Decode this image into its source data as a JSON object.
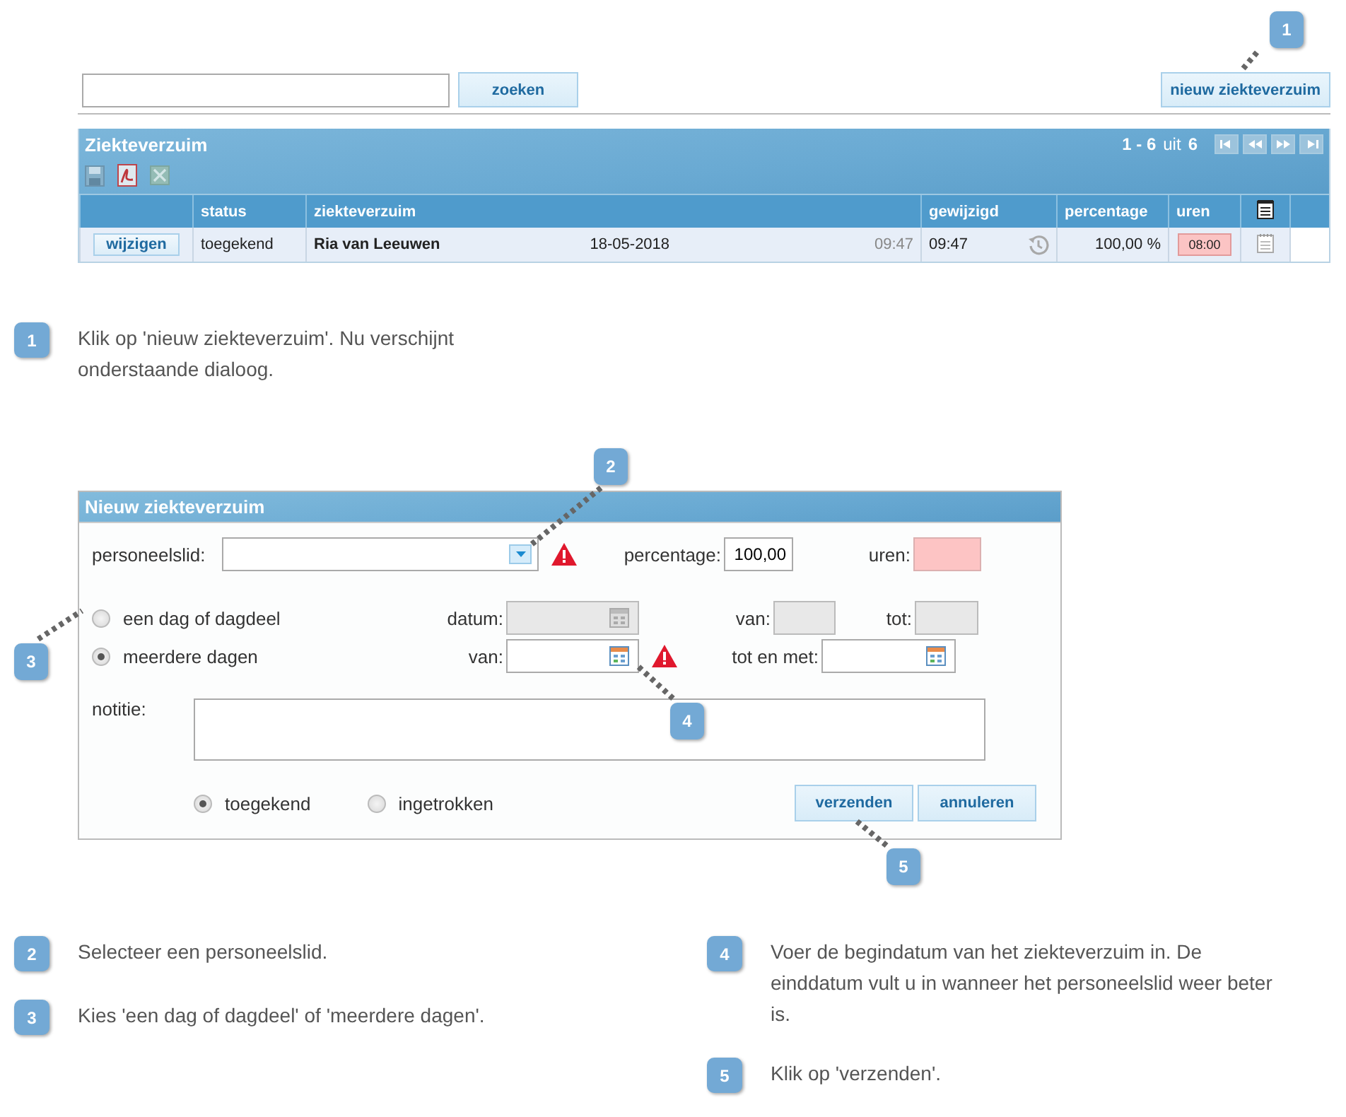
{
  "toolbar": {
    "search_button": "zoeken",
    "new_button": "nieuw ziekteverzuim"
  },
  "list_panel": {
    "title": "Ziekteverzuim",
    "range": "1 - 6",
    "of": "uit",
    "total": "6",
    "columns": [
      "status",
      "ziekteverzuim",
      "gewijzigd",
      "percentage",
      "uren"
    ],
    "rows": [
      {
        "action": "wijzigen",
        "status": "toegekend",
        "name": "Ria van Leeuwen",
        "date": "18-05-2018",
        "time": "09:47",
        "modified": "09:47",
        "percentage": "100,00 %",
        "hours": "08:00"
      }
    ]
  },
  "intro_step": {
    "number": "1",
    "text": "Klik op 'nieuw ziekteverzuim'. Nu verschijnt onderstaande dialoog."
  },
  "dialog": {
    "title": "Nieuw ziekteverzuim",
    "employee": {
      "label": "personeelslid:",
      "invalid": true
    },
    "percentage": {
      "label": "percentage:",
      "value": "100,00"
    },
    "hours": {
      "label": "uren:",
      "invalid": true
    },
    "period_options": [
      {
        "label": "een dag of dagdeel",
        "selected": false
      },
      {
        "label": "meerdere dagen",
        "selected": true
      }
    ],
    "date": {
      "label": "datum:",
      "disabled": true
    },
    "time_from": {
      "label": "van:",
      "disabled": true
    },
    "time_to": {
      "label": "tot:",
      "disabled": true
    },
    "from": {
      "label": "van:",
      "disabled": false,
      "invalid": true
    },
    "until": {
      "label": "tot en met:",
      "disabled": false
    },
    "note": {
      "label": "notitie:"
    },
    "status_options": [
      {
        "label": "toegekend",
        "selected": true
      },
      {
        "label": "ingetrokken",
        "selected": false
      }
    ],
    "buttons": [
      "verzenden",
      "annuleren"
    ]
  },
  "steps_left": [
    {
      "number": "2",
      "text": "Selecteer een personeelslid."
    },
    {
      "number": "3",
      "text": "Kies 'een dag of dagdeel' of 'meerdere dagen'."
    }
  ],
  "steps_right": [
    {
      "number": "4",
      "text": "Voer de begindatum van het ziekteverzuim in. De einddatum vult u in wanneer het personeelslid weer beter is."
    },
    {
      "number": "5",
      "text": "Klik op 'verzenden'."
    }
  ],
  "callouts": [
    "1",
    "2",
    "3",
    "4",
    "5"
  ]
}
